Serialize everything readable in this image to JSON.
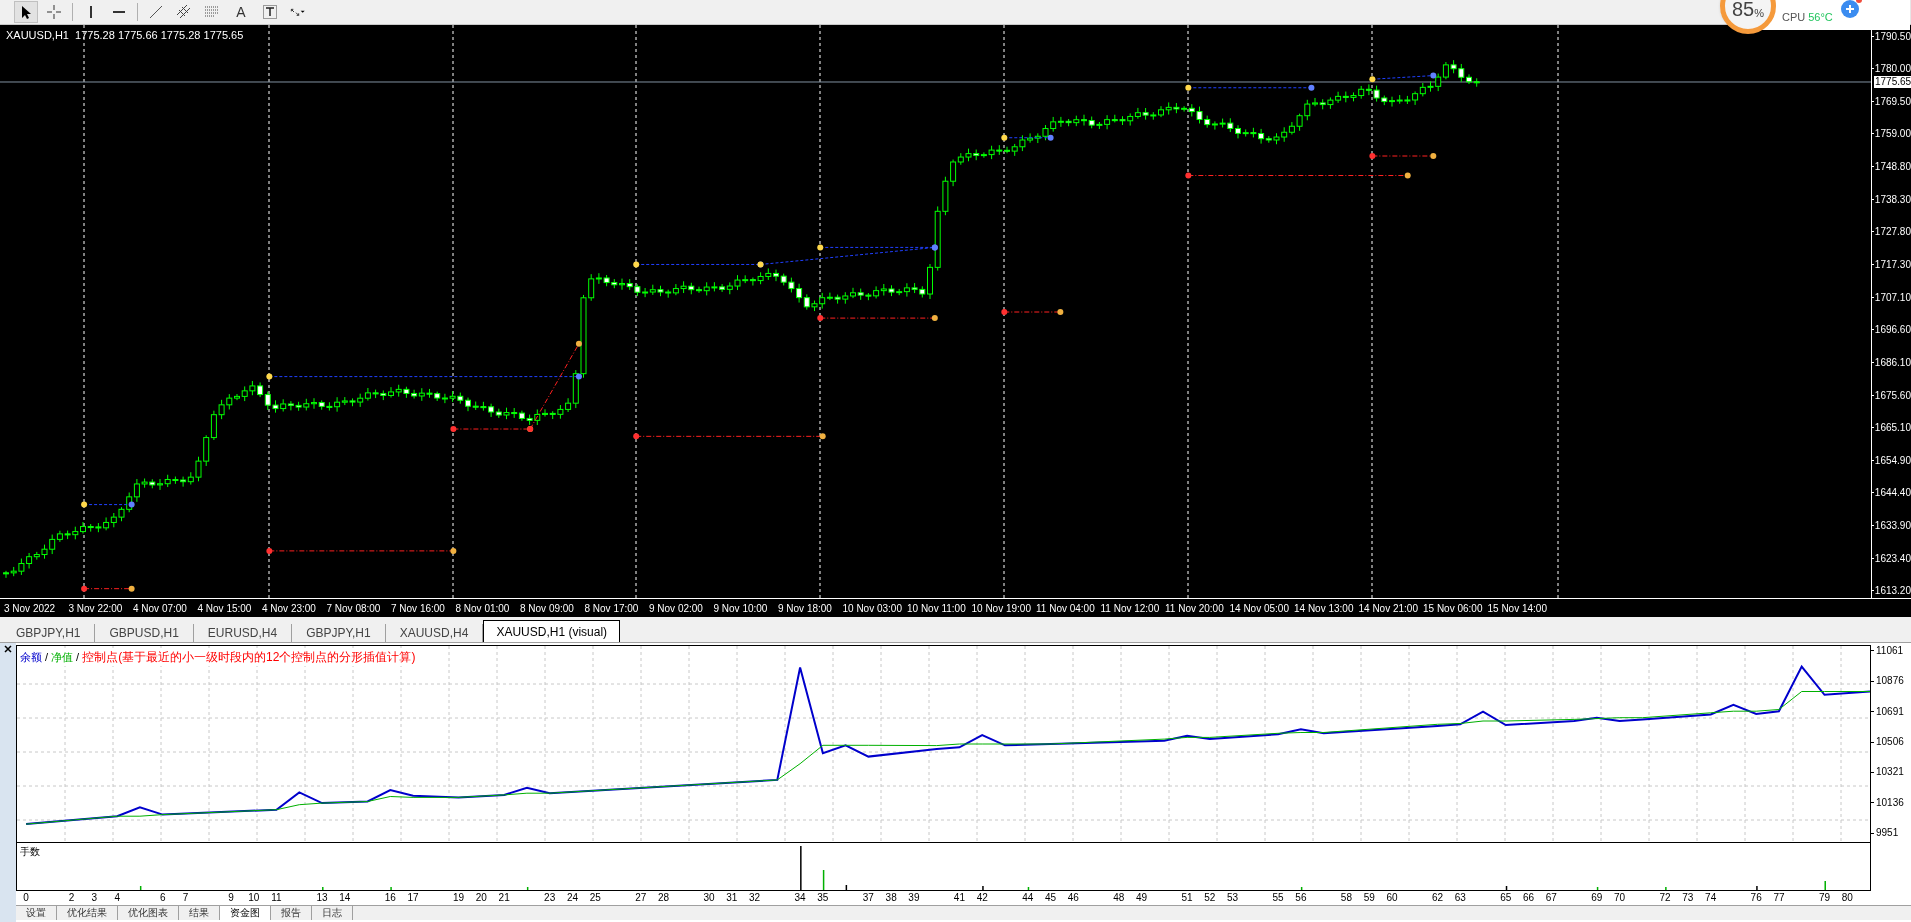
{
  "toolbar": {
    "tools": [
      {
        "kind": "cursor",
        "selected": true
      },
      {
        "kind": "crosshair",
        "selected": false
      },
      {
        "kind": "vline",
        "selected": false
      },
      {
        "kind": "hline",
        "selected": false
      },
      {
        "kind": "trendline",
        "selected": false
      },
      {
        "kind": "channel",
        "selected": false
      },
      {
        "kind": "fibo",
        "selected": false
      },
      {
        "kind": "text",
        "label": "A",
        "selected": false
      },
      {
        "kind": "label",
        "selected": false
      },
      {
        "kind": "arrows",
        "selected": false
      }
    ]
  },
  "system_widget": {
    "load": "85",
    "unit": "%",
    "cpu_label": "CPU",
    "cpu_temp": "56°C"
  },
  "chart": {
    "info": "XAUUSD,H1  1775.28 1775.66 1775.28 1775.65",
    "price_labels": [
      "1790.50",
      "1780.00",
      "1769.50",
      "1759.00",
      "1748.80",
      "1738.30",
      "1727.80",
      "1717.30",
      "1707.10",
      "1696.60",
      "1686.10",
      "1675.60",
      "1665.10",
      "1654.90",
      "1644.40",
      "1633.90",
      "1623.40",
      "1613.20"
    ],
    "current_price": "1775.65",
    "time_labels": [
      "3 Nov 2022",
      "3 Nov 22:00",
      "4 Nov 07:00",
      "4 Nov 15:00",
      "4 Nov 23:00",
      "7 Nov 08:00",
      "7 Nov 16:00",
      "8 Nov 01:00",
      "8 Nov 09:00",
      "8 Nov 17:00",
      "9 Nov 02:00",
      "9 Nov 10:00",
      "9 Nov 18:00",
      "10 Nov 03:00",
      "10 Nov 11:00",
      "10 Nov 19:00",
      "11 Nov 04:00",
      "11 Nov 12:00",
      "11 Nov 20:00",
      "14 Nov 05:00",
      "14 Nov 13:00",
      "14 Nov 21:00",
      "15 Nov 06:00",
      "15 Nov 14:00"
    ]
  },
  "chart_tabs": [
    {
      "label": "GBPJPY,H1",
      "selected": false
    },
    {
      "label": "GBPUSD,H1",
      "selected": false
    },
    {
      "label": "EURUSD,H4",
      "selected": false
    },
    {
      "label": "GBPJPY,H1",
      "selected": false
    },
    {
      "label": "XAUUSD,H4",
      "selected": false
    },
    {
      "label": "XAUUSD,H1 (visual)",
      "selected": true
    }
  ],
  "tester": {
    "legend_separators": [
      "/",
      "/"
    ],
    "control_points": {
      "label": "控制点(基于最近的小一级时段内的12个控制点的分形插值计算)",
      "color": "#ff0000"
    },
    "chart_data": {
      "type": "line",
      "x": [
        0,
        4,
        5,
        6,
        11,
        12,
        13,
        15,
        16,
        17,
        19,
        21,
        22,
        23,
        33,
        34,
        35,
        36,
        37,
        40,
        41,
        42,
        43,
        45,
        50,
        51,
        52,
        55,
        56,
        57,
        62,
        63,
        64,
        65,
        68,
        69,
        70,
        71,
        74,
        75,
        76,
        77,
        78,
        79,
        81
      ],
      "series": [
        {
          "name": "余额",
          "color": "#0000cc",
          "values": [
            10012,
            10060,
            10115,
            10070,
            10100,
            10205,
            10140,
            10150,
            10219,
            10185,
            10175,
            10190,
            10233,
            10200,
            10281,
            10966,
            10444,
            10492,
            10423,
            10470,
            10480,
            10554,
            10492,
            10500,
            10520,
            10550,
            10530,
            10560,
            10590,
            10565,
            10609,
            10620,
            10697,
            10616,
            10640,
            10660,
            10640,
            10650,
            10680,
            10738,
            10683,
            10700,
            10972,
            10800,
            10820
          ]
        },
        {
          "name": "净值",
          "color": "#00b000",
          "values": [
            10012,
            10060,
            10060,
            10070,
            10100,
            10130,
            10140,
            10150,
            10180,
            10175,
            10175,
            10190,
            10200,
            10200,
            10281,
            10380,
            10492,
            10492,
            10492,
            10490,
            10500,
            10500,
            10500,
            10500,
            10530,
            10540,
            10540,
            10565,
            10570,
            10570,
            10620,
            10625,
            10640,
            10640,
            10650,
            10655,
            10660,
            10660,
            10690,
            10700,
            10700,
            10710,
            10820,
            10820,
            10820
          ]
        }
      ],
      "xlim": [
        -0.4,
        81
      ],
      "ylim": [
        9903,
        11097
      ],
      "grid": true,
      "xticks": [
        0,
        2,
        3,
        4,
        6,
        7,
        9,
        10,
        11,
        13,
        14,
        16,
        17,
        19,
        20,
        21,
        23,
        24,
        25,
        27,
        28,
        30,
        31,
        32,
        34,
        35,
        37,
        38,
        39,
        41,
        42,
        44,
        45,
        46,
        48,
        49,
        51,
        52,
        53,
        55,
        56,
        58,
        59,
        60,
        62,
        63,
        65,
        66,
        67,
        69,
        70,
        72,
        73,
        74,
        76,
        77,
        79,
        80
      ],
      "yticks": [
        11061,
        10876,
        10691,
        10506,
        10321,
        10136,
        9951
      ]
    },
    "lots_label": "手数"
  },
  "bottom_tabs": [
    {
      "label": "设置",
      "selected": false
    },
    {
      "label": "优化结果",
      "selected": false
    },
    {
      "label": "优化图表",
      "selected": false
    },
    {
      "label": "结果",
      "selected": false
    },
    {
      "label": "资金图",
      "selected": true
    },
    {
      "label": "报告",
      "selected": false
    },
    {
      "label": "日志",
      "selected": false
    }
  ]
}
